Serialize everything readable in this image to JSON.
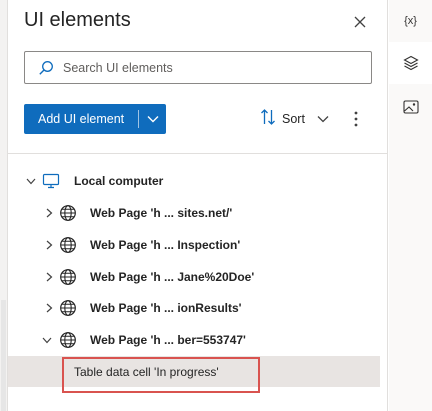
{
  "panel": {
    "title": "UI elements",
    "search_placeholder": "Search UI elements",
    "add_button_label": "Add UI element",
    "sort_label": "Sort"
  },
  "tree": {
    "root": {
      "label": "Local computer",
      "icon": "computer-icon",
      "expanded": true
    },
    "pages": [
      {
        "label": "Web Page 'h ... sites.net/'",
        "icon": "globe-icon",
        "expanded": false
      },
      {
        "label": "Web Page 'h ... Inspection'",
        "icon": "globe-icon",
        "expanded": false
      },
      {
        "label": "Web Page 'h ... Jane%20Doe'",
        "icon": "globe-icon",
        "expanded": false
      },
      {
        "label": "Web Page 'h ... ionResults'",
        "icon": "globe-icon",
        "expanded": false
      },
      {
        "label": "Web Page 'h ... ber=553747'",
        "icon": "globe-icon",
        "expanded": true
      }
    ],
    "selected_child": {
      "label": "Table data cell 'In progress'"
    }
  },
  "rail": {
    "variables_label": "{x}",
    "icons": [
      "variables-icon",
      "layers-icon",
      "image-icon"
    ]
  },
  "colors": {
    "accent": "#0f6cbd",
    "highlight": "#d9534f",
    "selected_bg": "#e8e4e2"
  }
}
